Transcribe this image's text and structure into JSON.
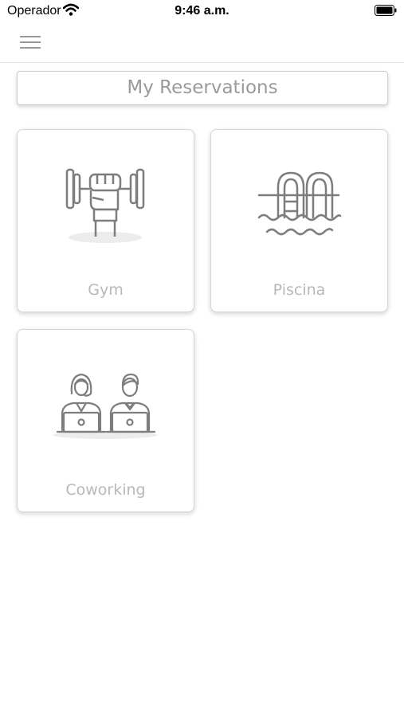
{
  "status_bar": {
    "carrier": "Operador",
    "time": "9:46 a.m.",
    "wifi_icon": "wifi-icon",
    "battery_icon": "battery-icon"
  },
  "nav": {
    "menu_icon": "hamburger-menu-icon"
  },
  "header": {
    "title": "My Reservations"
  },
  "amenities": [
    {
      "label": "Gym",
      "icon": "dumbbell-icon"
    },
    {
      "label": "Piscina",
      "icon": "pool-ladder-icon"
    },
    {
      "label": "Coworking",
      "icon": "coworking-people-icon"
    }
  ],
  "colors": {
    "icon_stroke": "#7d7d7d",
    "label_text": "#b8b8b8",
    "title_text": "#9a9a9a"
  }
}
